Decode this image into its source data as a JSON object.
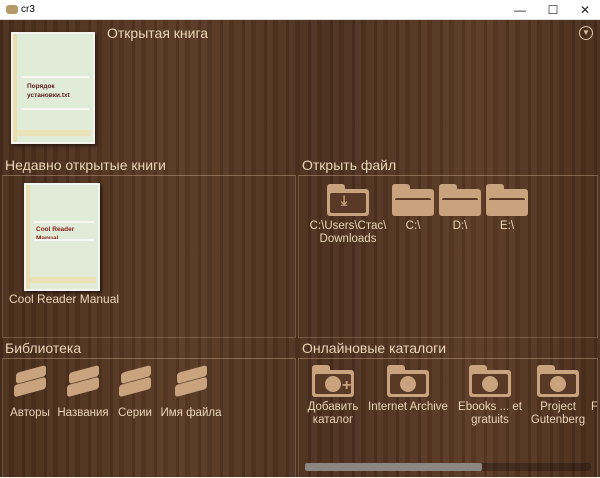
{
  "window": {
    "title": "cr3",
    "minimize": "—",
    "maximize": "☐",
    "close": "✕"
  },
  "current": {
    "header": "Открытая книга",
    "book_title": "Порядок установки.txt",
    "menu_icon": "chevron-down-circle-icon"
  },
  "recent": {
    "header": "Недавно открытые книги",
    "books": [
      {
        "cover_title": "Cool Reader Manual",
        "label": "Cool Reader Manual"
      }
    ]
  },
  "open_file": {
    "header": "Открыть файл",
    "items": [
      {
        "label": "C:\\Users\\Стас\\ Downloads",
        "icon": "download-folder-icon"
      },
      {
        "label": "C:\\",
        "icon": "folder-icon"
      },
      {
        "label": "D:\\",
        "icon": "folder-icon"
      },
      {
        "label": "E:\\",
        "icon": "folder-icon"
      }
    ]
  },
  "library": {
    "header": "Библиотека",
    "items": [
      {
        "label": "Авторы"
      },
      {
        "label": "Названия"
      },
      {
        "label": "Серии"
      },
      {
        "label": "Имя файла"
      }
    ]
  },
  "catalogs": {
    "header": "Онлайновые каталоги",
    "items": [
      {
        "label": "Добавить каталог"
      },
      {
        "label": "Internet Archive"
      },
      {
        "label": "Ebooks ... et gratuits"
      },
      {
        "label": "Project Gutenberg"
      },
      {
        "label": "F"
      }
    ],
    "scroll_fraction": 0.6
  }
}
